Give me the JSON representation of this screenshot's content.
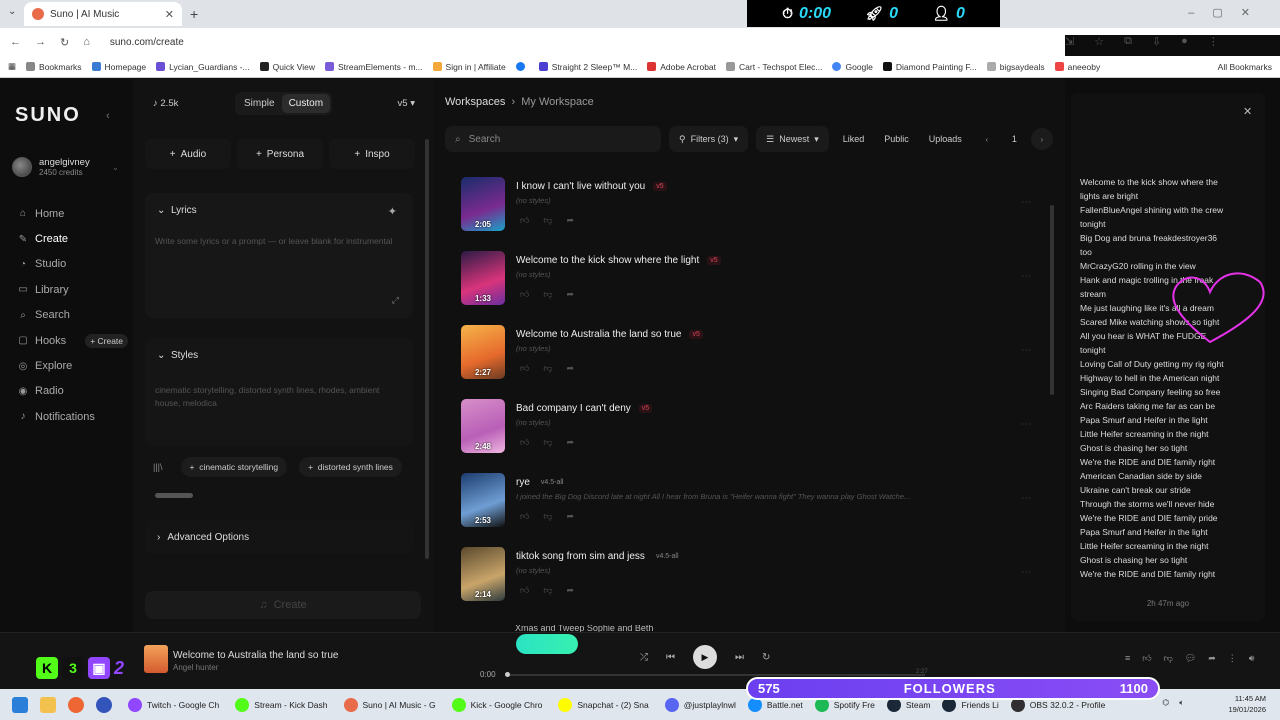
{
  "browser": {
    "tab_title": "Suno | AI Music",
    "url": "suno.com/create",
    "bookmarks": [
      "Bookmarks",
      "Homepage",
      "Lycian_Guardians -...",
      "Quick View",
      "StreamElements - m...",
      "Sign in | Affiliate",
      "",
      "Straight 2 Sleep™ M...",
      "Adobe Acrobat",
      "Cart - Techspot Elec...",
      "Google",
      "Diamond Painting F...",
      "bigsaydeals",
      "aneeoby"
    ],
    "all_bookmarks": "All Bookmarks"
  },
  "overlay_timer": {
    "time": "0:00",
    "rockets": "0",
    "users": "0"
  },
  "sidebar": {
    "logo": "SUNO",
    "user_name": "angelgivney",
    "user_credits": "2450 credits",
    "nav": [
      {
        "label": "Home",
        "icon": "home-icon"
      },
      {
        "label": "Create",
        "icon": "create-icon",
        "active": true
      },
      {
        "label": "Studio",
        "icon": "studio-icon"
      },
      {
        "label": "Library",
        "icon": "library-icon"
      },
      {
        "label": "Search",
        "icon": "search-icon"
      },
      {
        "label": "Hooks",
        "icon": "hooks-icon"
      },
      {
        "label": "Explore",
        "icon": "explore-icon"
      },
      {
        "label": "Radio",
        "icon": "radio-icon"
      },
      {
        "label": "Notifications",
        "icon": "bell-icon"
      }
    ],
    "hooks_create": "+ Create"
  },
  "create_panel": {
    "credits": "2.5k",
    "mode_simple": "Simple",
    "mode_custom": "Custom",
    "version": "v5",
    "add_audio": "Audio",
    "add_persona": "Persona",
    "add_inspo": "Inspo",
    "lyrics_label": "Lyrics",
    "lyrics_placeholder": "Write some lyrics or a prompt — or leave blank for instrumental",
    "styles_label": "Styles",
    "styles_value": "cinematic storytelling, distorted synth lines, rhodes, ambient house, melodica",
    "chips": [
      "cinematic storytelling",
      "distorted synth lines"
    ],
    "advanced": "Advanced Options",
    "create_button": "Create"
  },
  "workspace": {
    "crumb_root": "Workspaces",
    "crumb_current": "My Workspace",
    "search_placeholder": "Search",
    "filters": "Filters (3)",
    "sort": "Newest",
    "liked": "Liked",
    "public": "Public",
    "uploads": "Uploads",
    "page": "1",
    "songs": [
      {
        "title": "I know I can't live without you",
        "version": "v5",
        "style": "(no styles)",
        "duration": "2:05",
        "colors": [
          "#1a2c6b",
          "#7a2b8f",
          "#18a3c9"
        ]
      },
      {
        "title": "Welcome to the kick show where the light",
        "version": "v5",
        "style": "(no styles)",
        "duration": "1:33",
        "colors": [
          "#2b1b45",
          "#d9347b",
          "#6a2fa0"
        ]
      },
      {
        "title": "Welcome to Australia the land so true",
        "version": "v5",
        "style": "(no styles)",
        "duration": "2:27",
        "colors": [
          "#f6b44a",
          "#e66a2c",
          "#6b3b24"
        ]
      },
      {
        "title": "Bad company I can't deny",
        "version": "v5",
        "style": "(no styles)",
        "duration": "2:48",
        "colors": [
          "#d78fc9",
          "#b95fb7",
          "#f0b7e1"
        ]
      },
      {
        "title": "rye",
        "version": "v4.5-all",
        "style": "I joined the Big Dog Discord late at night All I hear from Bruna is \"Heifer wanna fight\" They wanna play Ghost Watche...",
        "duration": "2:53",
        "colors": [
          "#1d3d6e",
          "#6f9ed4",
          "#111"
        ]
      },
      {
        "title": "tiktok song from sim and jess",
        "version": "v4.5-all",
        "style": "(no styles)",
        "duration": "2:14",
        "colors": [
          "#5b4a2e",
          "#c9a56a",
          "#2c3a3d"
        ]
      }
    ],
    "partial_title": "Xmas and Tweep Sophie and Beth"
  },
  "lyrics_panel": {
    "lines": [
      "Welcome to the kick show where the",
      "lights are bright",
      "FallenBlueAngel shining with the crew",
      "tonight",
      "Big Dog and bruna freakdestroyer36",
      "too",
      "MrCrazyG20 rolling in the view",
      "Hank and magic trolling in the freak",
      "stream",
      "Me just laughing like it's all a dream",
      "Scared Mike watching shows so tight",
      "All you hear is WHAT the FUDGE",
      "tonight",
      "Loving Call of Duty getting my rig right",
      "Highway to hell in the American night",
      "Singing Bad Company feeling so free",
      "Arc Raiders taking me far as can be",
      "Papa Smurf and Heifer in the light",
      "Little Heifer screaming in the night",
      "Ghost is chasing her so tight",
      "We're the RIDE and DIE family right",
      "American Canadian side by side",
      "Ukraine can't break our stride",
      "Through the storms we'll never hide",
      "We're the RIDE and DIE family pride",
      "Papa Smurf and Heifer in the light",
      "Little Heifer screaming in the night",
      "Ghost is chasing her so tight",
      "We're the RIDE and DIE family right"
    ],
    "time_ago": "2h 47m ago"
  },
  "player": {
    "title": "Welcome to Australia the land so true",
    "artist": "Angel hunter",
    "time": "0:00",
    "total": "2:27",
    "progress": 0.0
  },
  "stream_overlay": {
    "followers_current": "575",
    "followers_label": "FOLLOWERS",
    "followers_goal": "1100"
  },
  "taskbar": {
    "apps": [
      "Twitch - Google Ch",
      "Stream - Kick Dash",
      "Suno | AI Music - G",
      "Kick - Google Chro",
      "Snapchat - (2) Sna",
      "@justplaylnwl",
      "Battle.net",
      "Spotify Fre",
      "Steam",
      "Friends Li",
      "OBS 32.0.2 - Profile"
    ],
    "time": "11:45 AM",
    "date": "19/01/2026"
  }
}
